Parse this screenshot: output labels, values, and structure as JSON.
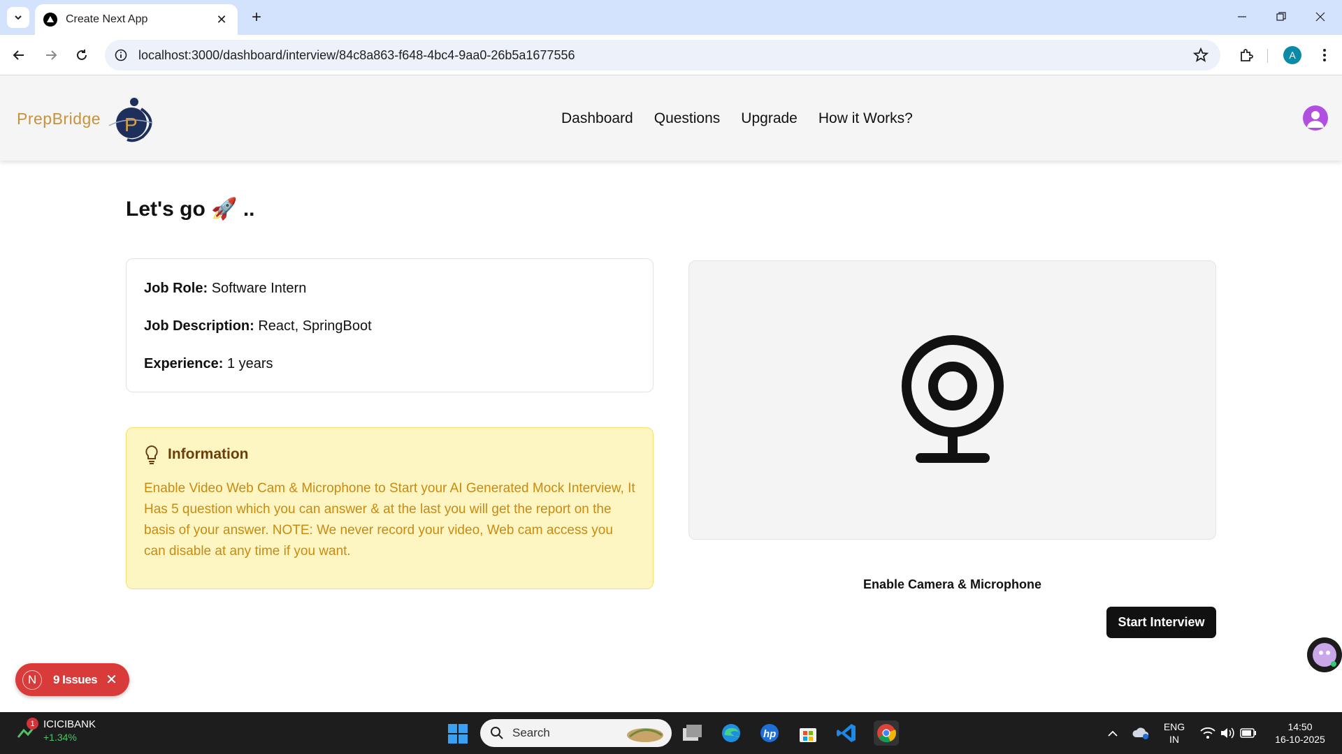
{
  "browser": {
    "tab_title": "Create Next App",
    "url": "localhost:3000/dashboard/interview/84c8a863-f648-4bc4-9aa0-26b5a1677556",
    "profile_initial": "A"
  },
  "app": {
    "brand": "PrepBridge",
    "logo_letter": "P",
    "nav": [
      "Dashboard",
      "Questions",
      "Upgrade",
      "How it Works?"
    ],
    "page_title": "Let's go 🚀 ..",
    "job": {
      "role_label": "Job Role:",
      "role_value": "Software Intern",
      "description_label": "Job Description:",
      "description_value": "React, SpringBoot",
      "experience_label": "Experience:",
      "experience_value": "1 years"
    },
    "info": {
      "heading": "Information",
      "text": "Enable Video Web Cam & Microphone to Start your AI Generated Mock Interview, It Has 5 question which you can answer & at the last you will get the report on the basis of your answer. NOTE: We never record your video, Web cam access you can disable at any time if you want."
    },
    "enable_camera_label": "Enable Camera & Microphone",
    "start_button_label": "Start Interview"
  },
  "dev_overlay": {
    "badge_letter": "N",
    "issues_label": "9 Issues"
  },
  "taskbar": {
    "stock_badge": "1",
    "stock_name": "ICICIBANK",
    "stock_change": "+1.34%",
    "search_placeholder": "Search",
    "lang_top": "ENG",
    "lang_bottom": "IN",
    "time": "14:50",
    "date": "16-10-2025"
  },
  "colors": {
    "brand_gold": "#c8923a",
    "info_bg": "#fdf6c2",
    "info_text": "#c98a12",
    "issues_red": "#d93b3b"
  }
}
